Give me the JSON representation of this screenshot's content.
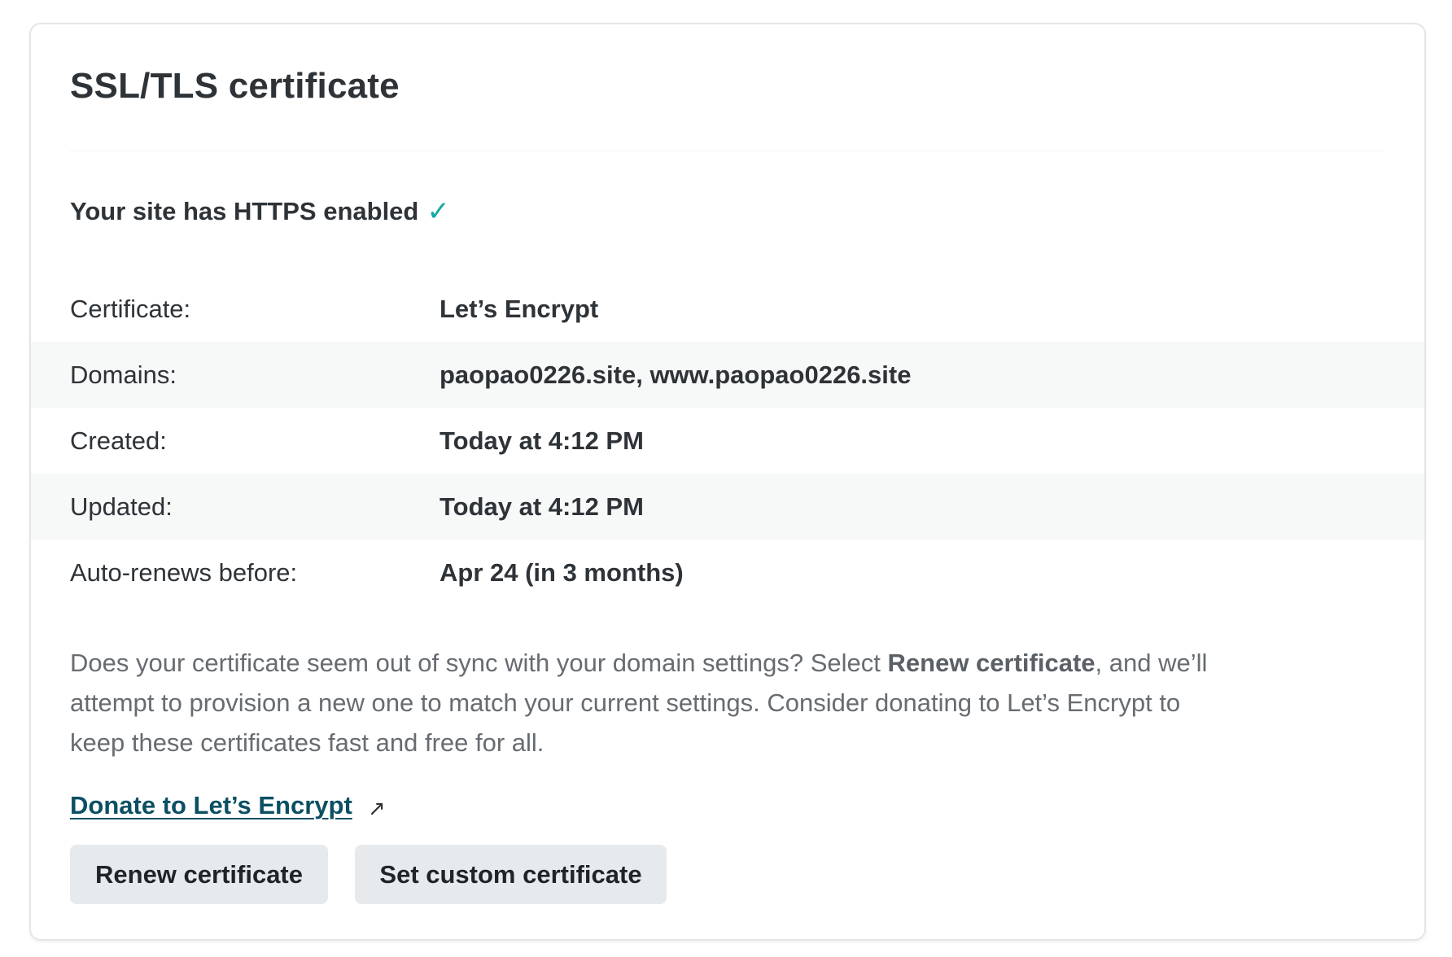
{
  "card": {
    "title": "SSL/TLS certificate",
    "https_status": "Your site has HTTPS enabled",
    "check_glyph": "✓",
    "details": [
      {
        "label": "Certificate:",
        "value": "Let’s Encrypt"
      },
      {
        "label": "Domains:",
        "value": "paopao0226.site, www.paopao0226.site"
      },
      {
        "label": "Created:",
        "value": "Today at 4:12 PM"
      },
      {
        "label": "Updated:",
        "value": "Today at 4:12 PM"
      },
      {
        "label": "Auto-renews before:",
        "value": "Apr 24 (in 3 months)"
      }
    ],
    "description": {
      "part1": "Does your certificate seem out of sync with your domain settings? Select ",
      "bold": "Renew certificate",
      "part2": ", and we’ll attempt to provision a new one to match your current settings. Consider donating to Let’s Encrypt to keep these certificates fast and free for all."
    },
    "donate_link": "Donate to Let’s Encrypt",
    "external_glyph": "↗",
    "buttons": {
      "renew": "Renew certificate",
      "custom": "Set custom certificate"
    }
  },
  "colors": {
    "accent_check": "#15a9a4",
    "link": "#0b4f63",
    "button_bg": "#e7eaec"
  },
  "icons": [
    "check-icon",
    "external-link-icon"
  ]
}
